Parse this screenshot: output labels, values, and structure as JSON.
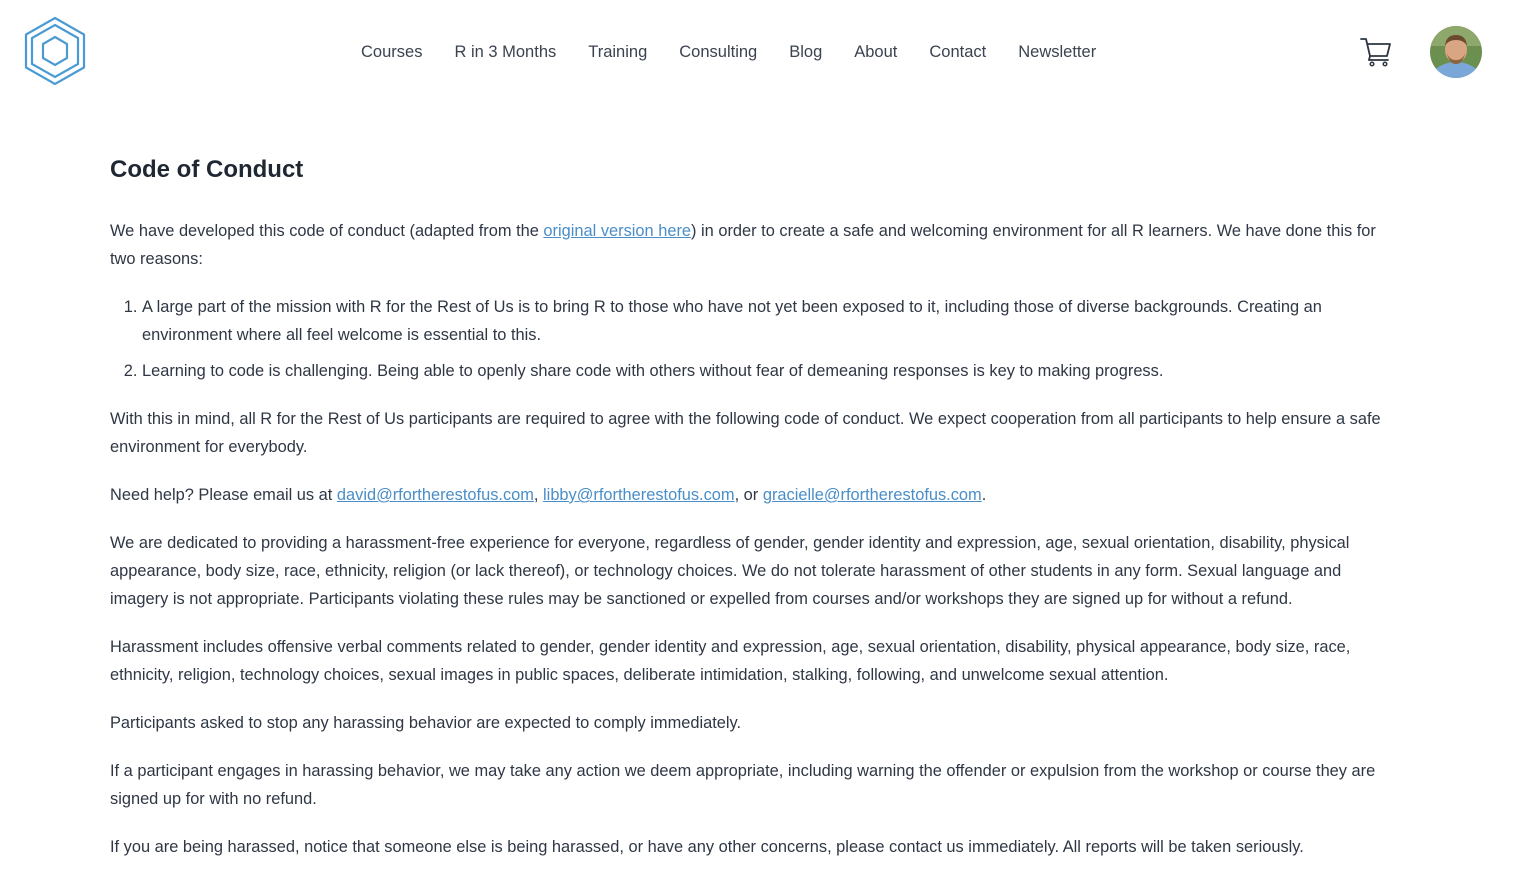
{
  "nav": {
    "items": [
      "Courses",
      "R in 3 Months",
      "Training",
      "Consulting",
      "Blog",
      "About",
      "Contact",
      "Newsletter"
    ]
  },
  "colors": {
    "brand": "#4a9ad4",
    "link": "#4a8ec9",
    "text": "#2f3745",
    "heading": "#1f2733"
  },
  "icons": {
    "logo": "hexagon-logo-icon",
    "cart": "shopping-cart-icon",
    "avatar": "user-avatar"
  },
  "content": {
    "title": "Code of Conduct",
    "intro_before": "We have developed this code of conduct (adapted from the ",
    "intro_link": "original version here",
    "intro_after": ") in order to create a safe and welcoming environment for all R learners. We have done this for two reasons:",
    "reasons": [
      "A large part of the mission with R for the Rest of Us is to bring R to those who have not yet been exposed to it, including those of diverse backgrounds. Creating an environment where all feel welcome is essential to this.",
      "Learning to code is challenging. Being able to openly share code with others without fear of demeaning responses is key to making progress."
    ],
    "agreement": "With this in mind, all R for the Rest of Us participants are required to agree with the following code of conduct. We expect cooperation from all participants to help ensure a safe environment for everybody.",
    "help_prefix": "Need help? Please email us at ",
    "email_1": "david@rfortherestofus.com",
    "sep_1": ", ",
    "email_2": "libby@rfortherestofus.com",
    "sep_2": ", or ",
    "email_3": "gracielle@rfortherestofus.com",
    "help_suffix": ".",
    "dedication": "We are dedicated to providing a harassment-free experience for everyone, regardless of gender, gender identity and expression, age, sexual orientation, disability, physical appearance, body size, race, ethnicity, religion (or lack thereof), or technology choices. We do not tolerate harassment of other students in any form. Sexual language and imagery is not appropriate. Participants violating these rules may be sanctioned or expelled from courses and/or workshops they are signed up for without a refund.",
    "harassment_def": "Harassment includes offensive verbal comments related to gender, gender identity and expression, age, sexual orientation, disability, physical appearance, body size, race, ethnicity, religion, technology choices, sexual images in public spaces, deliberate intimidation, stalking, following, and unwelcome sexual attention.",
    "comply": "Participants asked to stop any harassing behavior are expected to comply immediately.",
    "action": "If a participant engages in harassing behavior, we may take any action we deem appropriate, including warning the offender or expulsion from the workshop or course they are signed up for with no refund.",
    "report": "If you are being harassed, notice that someone else is being harassed, or have any other concerns, please contact us immediately. All reports will be taken seriously."
  }
}
